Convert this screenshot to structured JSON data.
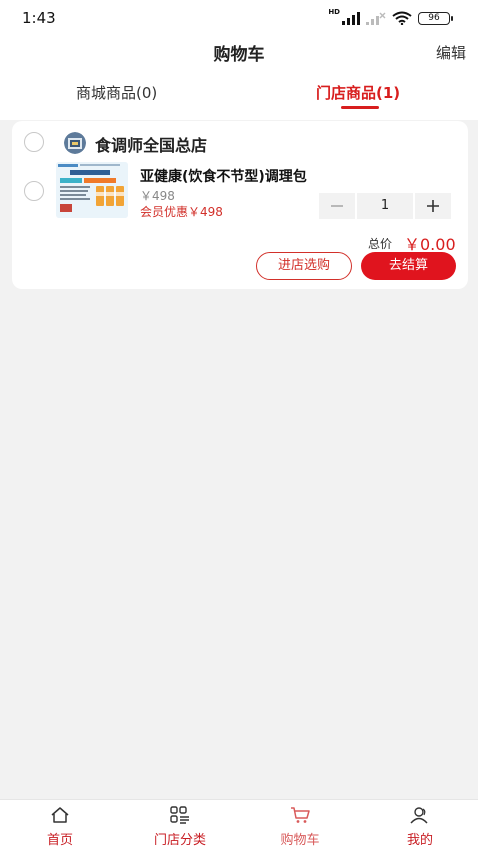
{
  "status_bar": {
    "time": "1:43",
    "network_label": "HD",
    "battery": "96"
  },
  "header": {
    "title": "购物车",
    "edit_label": "编辑"
  },
  "tabs": [
    {
      "label": "商城商品(0)",
      "active": false
    },
    {
      "label": "门店商品(1)",
      "active": true
    }
  ],
  "store": {
    "name": "食调师全国总店",
    "items": [
      {
        "name": "亚健康(饮食不节型)调理包",
        "price": "￥498",
        "member_price": "会员优惠￥498",
        "quantity": "1",
        "checked": false
      }
    ],
    "total_label": "总价",
    "total_value": "￥0.00",
    "visit_store_label": "进店选购",
    "checkout_label": "去结算"
  },
  "bottom_nav": [
    {
      "label": "首页",
      "icon": "home-icon"
    },
    {
      "label": "门店分类",
      "icon": "category-icon"
    },
    {
      "label": "购物车",
      "icon": "cart-icon",
      "active": true
    },
    {
      "label": "我的",
      "icon": "profile-icon"
    }
  ],
  "colors": {
    "accent": "#d81e1e",
    "checkout_button": "#e0141e",
    "background": "#f2f2f2"
  }
}
